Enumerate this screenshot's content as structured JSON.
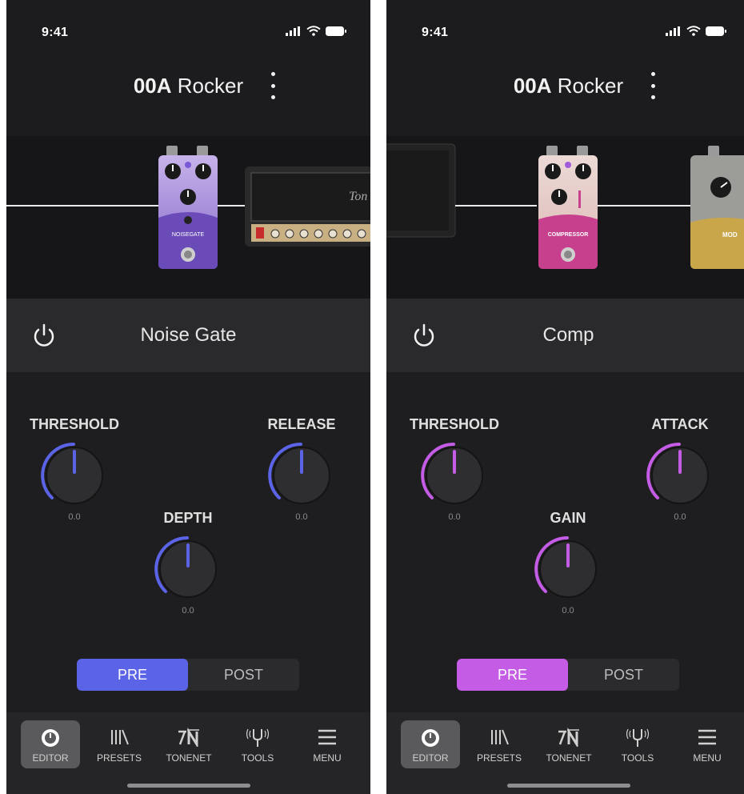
{
  "screens": [
    {
      "id": "noise-gate",
      "status_time": "9:41",
      "preset_number": "00A",
      "preset_name": "Rocker",
      "effect_name": "Noise Gate",
      "accent": "#5b63e6",
      "knobs": [
        {
          "label": "THRESHOLD",
          "value": "0.0"
        },
        {
          "label": "RELEASE",
          "value": "0.0"
        },
        {
          "label": "DEPTH",
          "value": "0.0"
        }
      ],
      "pedal_text": "NOISEGATE",
      "amp_text": "Ton",
      "toggle": {
        "pre": "PRE",
        "post": "POST",
        "selected": "PRE"
      },
      "tabs": [
        {
          "label": "EDITOR",
          "icon": "editor-icon",
          "active": true
        },
        {
          "label": "PRESETS",
          "icon": "presets-icon",
          "active": false
        },
        {
          "label": "TONENET",
          "icon": "tonenet-icon",
          "active": false
        },
        {
          "label": "TOOLS",
          "icon": "tools-icon",
          "active": false
        },
        {
          "label": "MENU",
          "icon": "menu-icon",
          "active": false
        }
      ]
    },
    {
      "id": "comp",
      "status_time": "9:41",
      "preset_number": "00A",
      "preset_name": "Rocker",
      "effect_name": "Comp",
      "accent": "#c45ce6",
      "knobs": [
        {
          "label": "THRESHOLD",
          "value": "0.0"
        },
        {
          "label": "ATTACK",
          "value": "0.0"
        },
        {
          "label": "GAIN",
          "value": "0.0"
        }
      ],
      "pedal_text": "COMPRESSOR",
      "mod_pedal_text": "MOD",
      "toggle": {
        "pre": "PRE",
        "post": "POST",
        "selected": "PRE"
      },
      "tabs": [
        {
          "label": "EDITOR",
          "icon": "editor-icon",
          "active": true
        },
        {
          "label": "PRESETS",
          "icon": "presets-icon",
          "active": false
        },
        {
          "label": "TONENET",
          "icon": "tonenet-icon",
          "active": false
        },
        {
          "label": "TOOLS",
          "icon": "tools-icon",
          "active": false
        },
        {
          "label": "MENU",
          "icon": "menu-icon",
          "active": false
        }
      ]
    }
  ]
}
